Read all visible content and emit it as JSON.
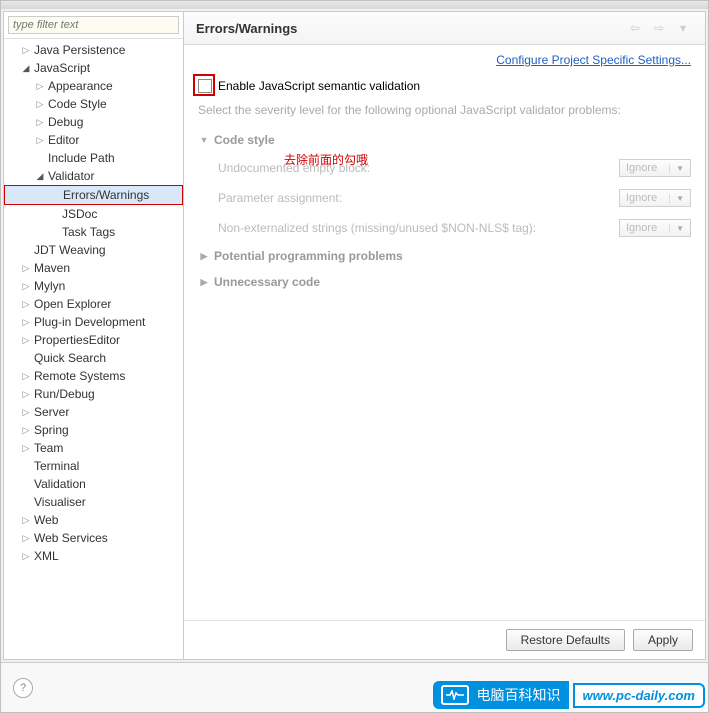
{
  "filter_placeholder": "type filter text",
  "tree": {
    "items": [
      {
        "label": "Java Persistence",
        "expand": "closed",
        "indent": 1
      },
      {
        "label": "JavaScript",
        "expand": "open",
        "indent": 1
      },
      {
        "label": "Appearance",
        "expand": "closed",
        "indent": 2
      },
      {
        "label": "Code Style",
        "expand": "closed",
        "indent": 2
      },
      {
        "label": "Debug",
        "expand": "closed",
        "indent": 2
      },
      {
        "label": "Editor",
        "expand": "closed",
        "indent": 2
      },
      {
        "label": "Include Path",
        "expand": "none",
        "indent": 2
      },
      {
        "label": "Validator",
        "expand": "open",
        "indent": 2
      },
      {
        "label": "Errors/Warnings",
        "expand": "none",
        "indent": 3,
        "selected": true,
        "highlighted": true
      },
      {
        "label": "JSDoc",
        "expand": "none",
        "indent": 3
      },
      {
        "label": "Task Tags",
        "expand": "none",
        "indent": 3
      },
      {
        "label": "JDT Weaving",
        "expand": "none",
        "indent": 1
      },
      {
        "label": "Maven",
        "expand": "closed",
        "indent": 1
      },
      {
        "label": "Mylyn",
        "expand": "closed",
        "indent": 1
      },
      {
        "label": "Open Explorer",
        "expand": "closed",
        "indent": 1
      },
      {
        "label": "Plug-in Development",
        "expand": "closed",
        "indent": 1
      },
      {
        "label": "PropertiesEditor",
        "expand": "closed",
        "indent": 1
      },
      {
        "label": "Quick Search",
        "expand": "none",
        "indent": 1
      },
      {
        "label": "Remote Systems",
        "expand": "closed",
        "indent": 1
      },
      {
        "label": "Run/Debug",
        "expand": "closed",
        "indent": 1
      },
      {
        "label": "Server",
        "expand": "closed",
        "indent": 1
      },
      {
        "label": "Spring",
        "expand": "closed",
        "indent": 1
      },
      {
        "label": "Team",
        "expand": "closed",
        "indent": 1
      },
      {
        "label": "Terminal",
        "expand": "none",
        "indent": 1
      },
      {
        "label": "Validation",
        "expand": "none",
        "indent": 1
      },
      {
        "label": "Visualiser",
        "expand": "none",
        "indent": 1
      },
      {
        "label": "Web",
        "expand": "closed",
        "indent": 1
      },
      {
        "label": "Web Services",
        "expand": "closed",
        "indent": 1
      },
      {
        "label": "XML",
        "expand": "closed",
        "indent": 1
      }
    ]
  },
  "panel": {
    "title": "Errors/Warnings",
    "config_link": "Configure Project Specific Settings...",
    "enable_label": "Enable JavaScript semantic validation",
    "description": "Select the severity level for the following optional JavaScript validator problems:",
    "sections": [
      {
        "label": "Code style",
        "state": "open"
      },
      {
        "label": "Potential programming problems",
        "state": "closed"
      },
      {
        "label": "Unnecessary code",
        "state": "closed"
      }
    ],
    "settings": [
      {
        "label": "Undocumented empty block:",
        "value": "Ignore"
      },
      {
        "label": "Parameter assignment:",
        "value": "Ignore"
      },
      {
        "label": "Non-externalized strings (missing/unused $NON-NLS$ tag):",
        "value": "Ignore"
      }
    ],
    "annotation": "去除前面的勾哦",
    "restore_btn": "Restore Defaults",
    "apply_btn": "Apply"
  },
  "watermark": {
    "text": "电脑百科知识",
    "url": "www.pc-daily.com"
  }
}
